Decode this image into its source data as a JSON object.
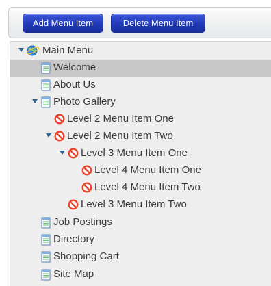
{
  "toolbar": {
    "add_label": "Add Menu Item",
    "delete_label": "Delete Menu Item"
  },
  "tree": {
    "root": {
      "label": "Main Menu",
      "icon": "globe-icon"
    },
    "items": [
      {
        "label": "Welcome",
        "icon": "page-icon",
        "selected": true
      },
      {
        "label": "About Us",
        "icon": "page-icon"
      },
      {
        "label": "Photo Gallery",
        "icon": "page-icon",
        "expanded": true
      },
      {
        "label": "Level 2 Menu Item One",
        "icon": "disabled-icon"
      },
      {
        "label": "Level 2 Menu Item Two",
        "icon": "disabled-icon",
        "expanded": true
      },
      {
        "label": "Level 3 Menu Item One",
        "icon": "disabled-icon",
        "expanded": true
      },
      {
        "label": "Level 4 Menu Item One",
        "icon": "disabled-icon"
      },
      {
        "label": "Level 4 Menu Item Two",
        "icon": "disabled-icon"
      },
      {
        "label": "Level 3 Menu Item Two",
        "icon": "disabled-icon"
      },
      {
        "label": "Job Postings",
        "icon": "page-icon"
      },
      {
        "label": "Directory",
        "icon": "page-icon"
      },
      {
        "label": "Shopping Cart",
        "icon": "page-icon"
      },
      {
        "label": "Site Map",
        "icon": "page-icon"
      }
    ]
  },
  "colors": {
    "button_blue": "#2039b8",
    "tree_background": "#eeeeee",
    "selected_row": "#c8c8c8",
    "text": "#3c3c3c",
    "disabled_red": "#e8452c"
  }
}
